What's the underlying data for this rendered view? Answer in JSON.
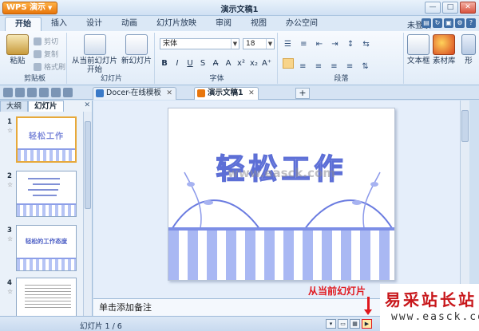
{
  "window": {
    "app_button": "WPS 演示",
    "title": "演示文稿1"
  },
  "ribbon_tabs": [
    "开始",
    "插入",
    "设计",
    "动画",
    "幻灯片放映",
    "审阅",
    "视图",
    "办公空间"
  ],
  "account": {
    "login_label": "未登录"
  },
  "groups": {
    "clipboard": {
      "label": "剪贴板",
      "paste": "粘贴",
      "cut": "剪切",
      "copy": "复制",
      "format_painter": "格式刷"
    },
    "slides": {
      "label": "幻灯片",
      "play_from_current_1": "从当前幻灯片",
      "play_from_current_2": "开始",
      "new_slide": "新幻灯片"
    },
    "font": {
      "label": "字体",
      "font_name": "宋体",
      "font_size": "18"
    },
    "paragraph": {
      "label": "段落"
    },
    "extra": {
      "textbox": "文本框",
      "material": "素材库",
      "shape": "形"
    }
  },
  "doc_tabs": [
    {
      "label": "Docer-在线模板",
      "active": false
    },
    {
      "label": "演示文稿1",
      "active": true
    }
  ],
  "left_panel": {
    "tabs": [
      "大纲",
      "幻灯片"
    ],
    "thumbnails": [
      {
        "number": "1",
        "star": "☆",
        "title": "轻松工作"
      },
      {
        "number": "2",
        "star": "☆",
        "title": ""
      },
      {
        "number": "3",
        "star": "☆",
        "title": "轻松的工作态度"
      },
      {
        "number": "4",
        "star": "☆",
        "title": ""
      }
    ]
  },
  "slide": {
    "title": "轻松工作",
    "watermark": "www.easck.com"
  },
  "notes": {
    "placeholder": "单击添加备注"
  },
  "status": {
    "slide_count": "幻灯片 1 / 6"
  },
  "annotation": {
    "text": "从当前幻灯片"
  },
  "logo": {
    "name": "易采站长站",
    "url": "www.easck.com"
  },
  "colors": {
    "accent_orange": "#e8760c",
    "annotation_red": "#e0181e",
    "slide_stripe": "#a9b8f3"
  }
}
